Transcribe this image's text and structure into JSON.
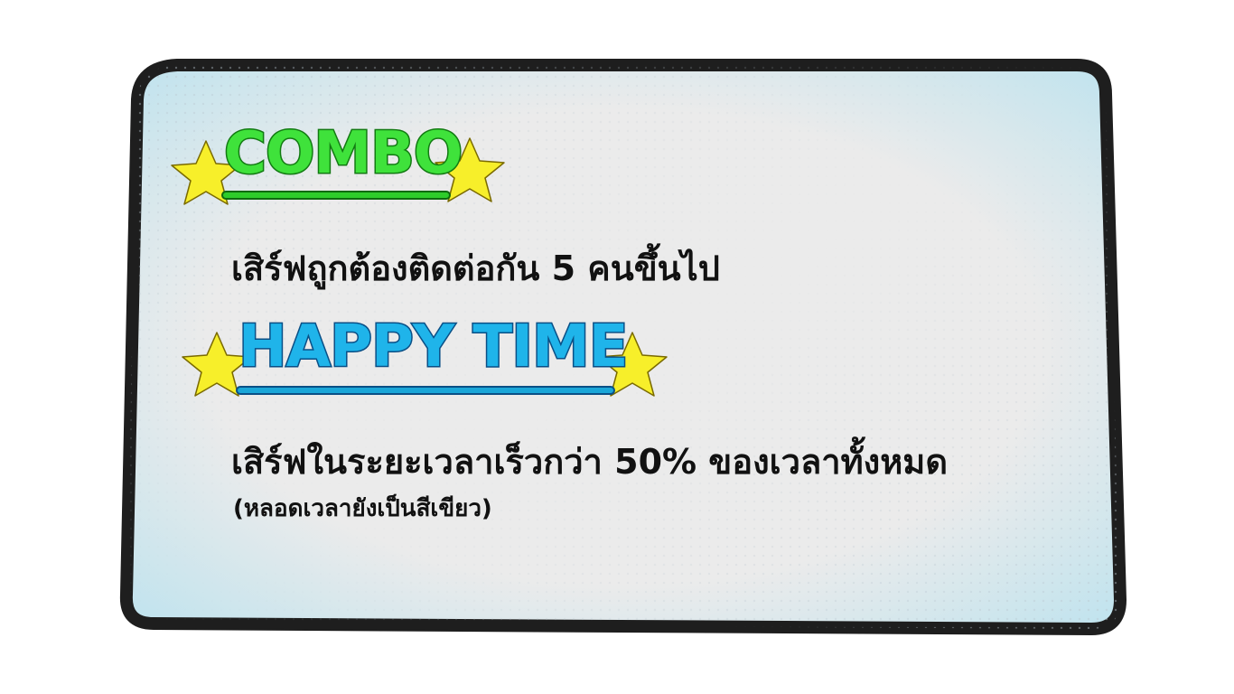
{
  "panel": {
    "combo": {
      "title": "COMBO",
      "description": "เสิร์ฟถูกต้องติดต่อกัน 5 คนขึ้นไป",
      "title_color": "#3fe23b",
      "underline_color": "#2ecc2a"
    },
    "happy_time": {
      "title": "HAPPY TIME",
      "description": "เสิร์ฟในระยะเวลาเร็วกว่า 50% ของเวลาทั้งหมด",
      "note": "(หลอดเวลายังเป็นสีเขียว)",
      "title_color": "#1fb4ea",
      "underline_color": "#1aa6d8"
    },
    "colors": {
      "border": "#1e1e1e",
      "fill": "#ebebeb",
      "glow": "#bfe3ee",
      "star": "#f7ef2a",
      "star_outline": "#7a6a00"
    },
    "icons": [
      "star-icon"
    ]
  }
}
